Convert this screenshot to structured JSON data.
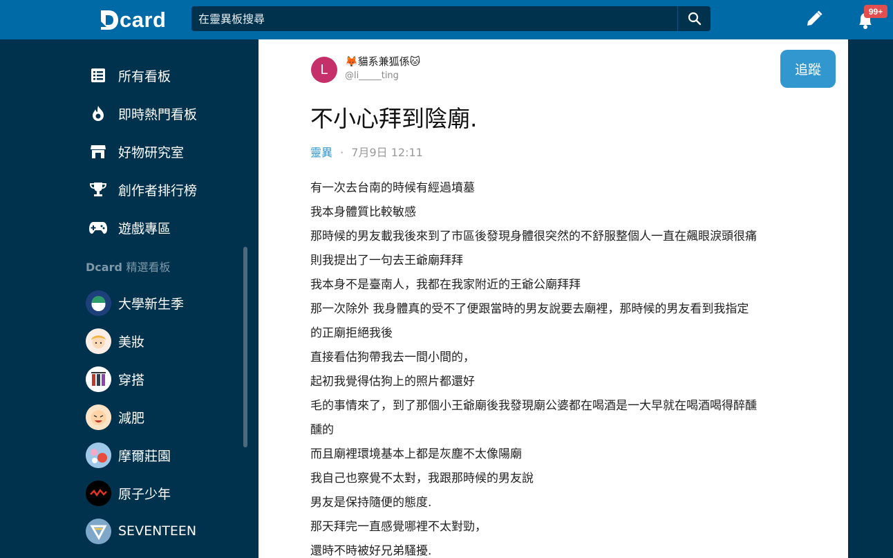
{
  "header": {
    "logo_text": "card",
    "search_placeholder": "在靈異板搜尋",
    "notification_count": "99+"
  },
  "sidebar": {
    "nav": [
      {
        "label": "所有看板",
        "icon": "list-icon"
      },
      {
        "label": "即時熱門看板",
        "icon": "flame-icon"
      },
      {
        "label": "好物研究室",
        "icon": "store-icon"
      },
      {
        "label": "創作者排行榜",
        "icon": "trophy-icon"
      },
      {
        "label": "遊戲專區",
        "icon": "gamepad-icon"
      }
    ],
    "section_brand": "Dcard",
    "section_title": "精選看板",
    "boards": [
      {
        "label": "大學新生季",
        "color": "#1d3f7a"
      },
      {
        "label": "美妝",
        "color": "#f3e4d8"
      },
      {
        "label": "穿搭",
        "color": "#ffffff"
      },
      {
        "label": "減肥",
        "color": "#fde4c6"
      },
      {
        "label": "摩爾莊園",
        "color": "#9fc7e8"
      },
      {
        "label": "原子少年",
        "color": "#000000"
      },
      {
        "label": "SEVENTEEN",
        "color": "#7fa7c9"
      }
    ]
  },
  "post": {
    "author_avatar_letter": "L",
    "author_name": "🦊貓系兼狐係🐱",
    "author_handle": "@li_____ting",
    "follow_label": "追蹤",
    "title": "不小心拜到陰廟.",
    "forum": "靈異",
    "separator": "·",
    "date": "7月9日 12:11",
    "lines": [
      "有一次去台南的時候有經過墳墓",
      "我本身體質比較敏感",
      "那時候的男友載我後來到了市區後發現身體很突然的不舒服整個人一直在飆眼淚頭很痛",
      "則我提出了一句去王爺廟拜拜",
      "我本身不是臺南人，我都在我家附近的王爺公廟拜拜",
      "那一次除外 我身體真的受不了便跟當時的男友說要去廟裡，那時候的男友看到我指定",
      "的正廟拒絕我後",
      "直接看估狗帶我去一間小間的，",
      "起初我覺得估狗上的照片都還好",
      "毛的事情來了，到了那個小王爺廟後我發現廟公婆都在喝酒是一大早就在喝酒喝得醉醺",
      "醺的",
      "而且廟裡環境基本上都是灰塵不太像陽廟",
      "我自己也察覺不太對，我跟那時候的男友說",
      "男友是保持隨便的態度.",
      "那天拜完一直感覺哪裡不太對勁，",
      "還時不時被好兄弟騷擾."
    ]
  },
  "colors": {
    "topbar": "#006aa6",
    "sidebar": "#00324e",
    "accent": "#3397cf"
  }
}
